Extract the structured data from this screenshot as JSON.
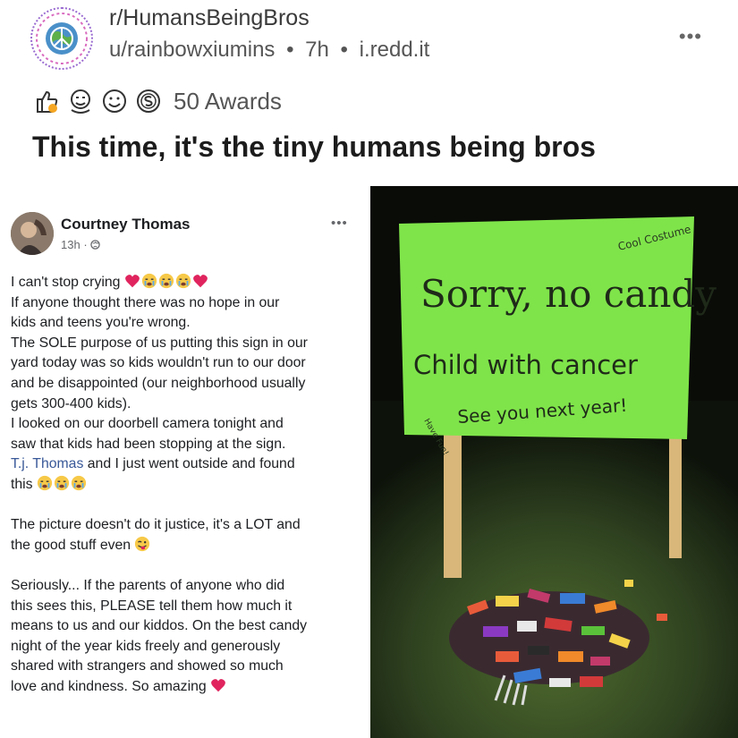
{
  "post": {
    "subreddit": "r/HumansBeingBros",
    "author": "u/rainbowxiumins",
    "age": "7h",
    "domain": "i.redd.it",
    "separator": "•",
    "more_label": "•••",
    "awards_label": "50 Awards",
    "title": "This time, it's the tiny humans being bros"
  },
  "facebook_post": {
    "name": "Courtney Thomas",
    "time": "13h",
    "more_label": "•••",
    "lines": {
      "l1": "I can't stop crying",
      "l2": "If anyone thought there was no hope in our",
      "l3": "kids and teens you're wrong.",
      "l4": "The SOLE purpose of us putting this sign in our",
      "l5": "yard today was so kids wouldn't run to our door",
      "l6": "and be disappointed (our neighborhood usually",
      "l7": "gets 300-400 kids).",
      "l8": "I looked on our doorbell camera tonight and",
      "l9": "saw that kids had been stopping at the sign.",
      "l10_tag": "T.j. Thomas",
      "l10_rest": " and I just went outside and found",
      "l11": "this",
      "l12": "The picture doesn't do it justice, it's a LOT and",
      "l13": "the good stuff even",
      "l14": "Seriously... If the parents of anyone who did",
      "l15": "this sees this, PLEASE tell them how much it",
      "l16": "means to us and our kiddos. On the best candy",
      "l17": "night of the year kids freely and generously",
      "l18": "shared with strangers and showed so much",
      "l19": "love and kindness. So amazing"
    }
  },
  "sign": {
    "line1": "Sorry, no candy",
    "line2": "Child with cancer",
    "line3": "See you next year!",
    "corner_note": "Cool Costume",
    "side_note": "Have Fun!",
    "color": "#7fe44a"
  },
  "colors": {
    "accent_link": "#385898",
    "heart": "#e0245e",
    "emoji": "#f7c948"
  }
}
